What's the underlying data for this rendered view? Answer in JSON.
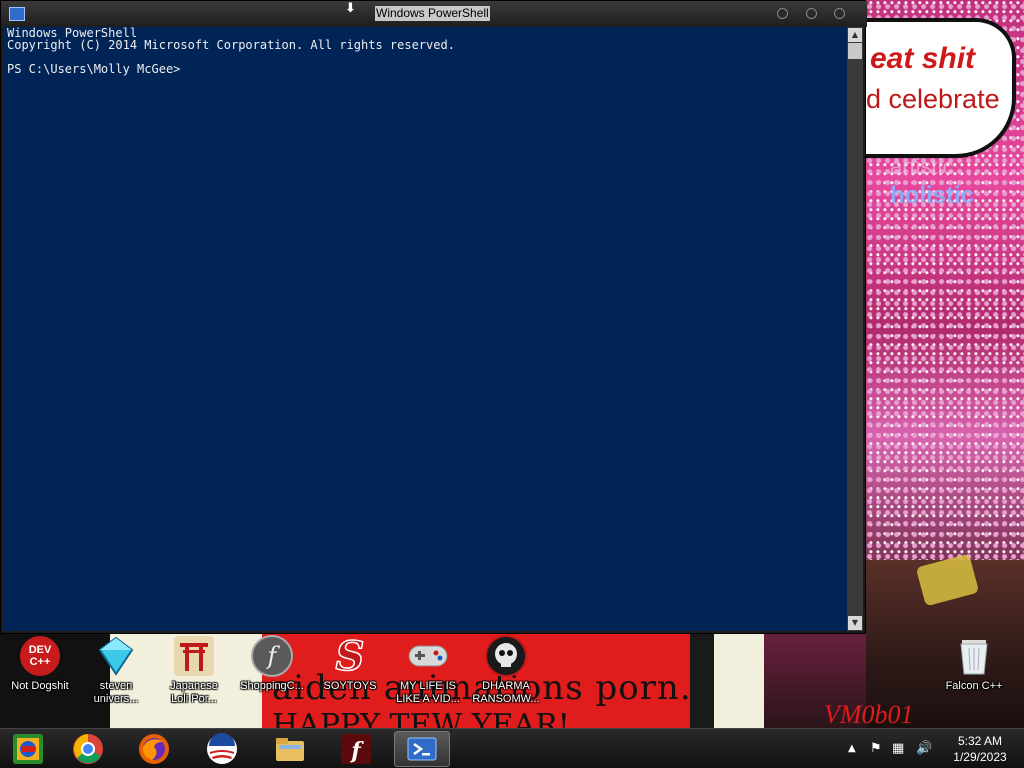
{
  "window": {
    "title": "Windows PowerShell",
    "console_lines": [
      "Windows PowerShell",
      "Copyright (C) 2014 Microsoft Corporation. All rights reserved.",
      "",
      "PS C:\\Users\\Molly McGee>"
    ],
    "background_color": "#012456",
    "text_color": "#eeedf0"
  },
  "wallpaper": {
    "bubble_line1": "eat shit",
    "bubble_line2": "d celebrate",
    "holistic": "holistic",
    "artistic": "artistic",
    "banner_line1": "aiden animations porn.",
    "banner_line2": "HAPPY TEW YEAR!",
    "signature": "VM0b01"
  },
  "desktop_icons": [
    {
      "label": "Not Dogshit",
      "icon": "dev-cpp-icon"
    },
    {
      "label": "steven\nunivers...",
      "icon": "diamond-icon"
    },
    {
      "label": "Japanese\nLoli Por...",
      "icon": "torii-icon"
    },
    {
      "label": "ShoppingC...",
      "icon": "flash-icon"
    },
    {
      "label": "SOYTOYS",
      "icon": "s-logo-icon"
    },
    {
      "label": "MY LIFE IS\nLIKE A VID...",
      "icon": "gamepad-icon"
    },
    {
      "label": "DHARMA\nRANSOMW...",
      "icon": "skull-icon"
    },
    {
      "label": "Falcon C++",
      "icon": "recycle-bin-icon"
    }
  ],
  "taskbar": {
    "pinned": [
      {
        "name": "start-button",
        "icon": "colorful-windows-icon"
      },
      {
        "name": "chrome",
        "icon": "chrome-icon"
      },
      {
        "name": "firefox",
        "icon": "firefox-icon"
      },
      {
        "name": "obama-logo",
        "icon": "obama-logo-icon"
      },
      {
        "name": "file-explorer",
        "icon": "folder-icon"
      },
      {
        "name": "flash",
        "icon": "flash-f-icon"
      },
      {
        "name": "powershell",
        "icon": "powershell-icon"
      }
    ],
    "tray_icons": [
      "chevron-up-icon",
      "flag-icon",
      "network-icon",
      "volume-icon"
    ],
    "clock_time": "5:32 AM",
    "clock_date": "1/29/2023"
  }
}
